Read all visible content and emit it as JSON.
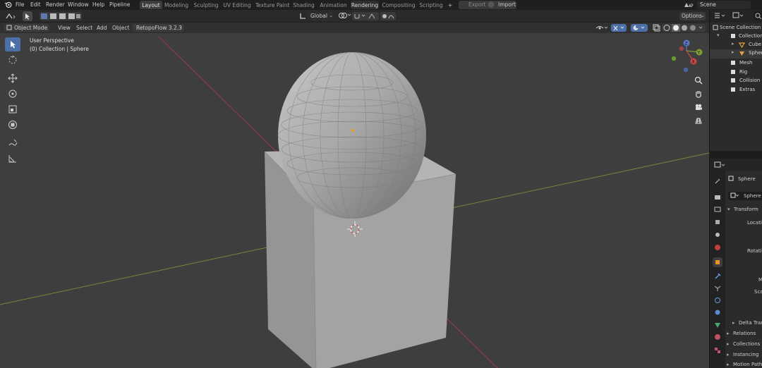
{
  "menu": {
    "items": [
      "File",
      "Edit",
      "Render",
      "Window",
      "Help",
      "Pipeline"
    ]
  },
  "workspaces": [
    "Layout",
    "Modeling",
    "Sculpting",
    "UV Editing",
    "Texture Paint",
    "Shading",
    "Animation",
    "Rendering",
    "Compositing",
    "Scripting"
  ],
  "workspace_active": "Layout",
  "add_tab_label": "+",
  "topbar_right": {
    "export_label": "Export",
    "import_label": "Import",
    "scene_name": "Scene"
  },
  "toolbar": {
    "orientation": "Global",
    "options_label": "Options"
  },
  "header": {
    "mode": "Object Mode",
    "view": "View",
    "select": "Select",
    "add": "Add",
    "object": "Object",
    "addon": "RetopoFlow 3.2.3"
  },
  "viewport": {
    "perspective": "User Perspective",
    "collection_info": "(0) Collection | Sphere",
    "gizmo": {
      "x": "X",
      "y": "Y",
      "z": "Z"
    },
    "colors": {
      "background": "#3e3e3e",
      "x_axis": "#9a3a4a",
      "y_axis": "#6e8a3c",
      "face": "#9b9b9b"
    }
  },
  "outliner": {
    "root": "Scene Collection",
    "items": [
      {
        "label": "Collection",
        "level": 1
      },
      {
        "label": "Cube",
        "level": 2
      },
      {
        "label": "Sphere",
        "level": 2
      },
      {
        "label": "Mesh",
        "level": 1
      },
      {
        "label": "Rig",
        "level": 1
      },
      {
        "label": "Collision",
        "level": 1
      },
      {
        "label": "Extras",
        "level": 1
      }
    ]
  },
  "properties": {
    "object_name": "Sphere",
    "data_name": "Sphere",
    "transform": "Transform",
    "location": "Locatio",
    "rotation": "Rotati",
    "mode": "M",
    "scale": "Sca",
    "delta": "Delta Trans",
    "sections": [
      "Relations",
      "Collections",
      "Instancing",
      "Motion Path"
    ]
  }
}
